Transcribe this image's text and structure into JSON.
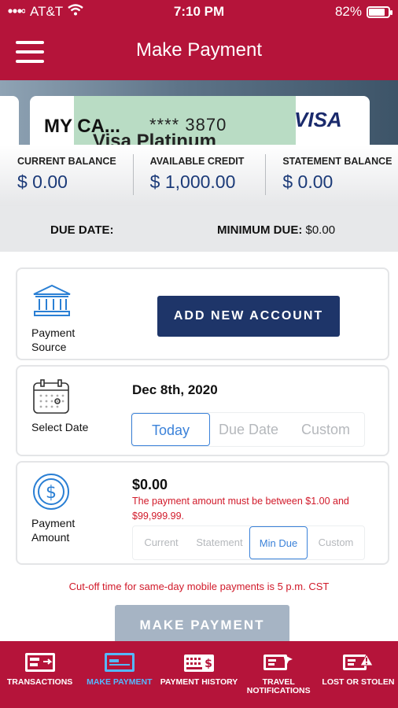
{
  "status": {
    "carrier": "AT&T",
    "time": "7:10 PM",
    "battery": "82%",
    "battery_level": 0.82
  },
  "header": {
    "title": "Make Payment",
    "menu_icon": "hamburger-icon"
  },
  "card": {
    "name": "MY CA...",
    "number": "**** 3870",
    "product": "Visa Platinum",
    "brand": "VISA"
  },
  "balances": [
    {
      "label": "CURRENT BALANCE",
      "value": "$ 0.00"
    },
    {
      "label": "AVAILABLE CREDIT",
      "value": "$ 1,000.00"
    },
    {
      "label": "STATEMENT BALANCE",
      "value": "$ 0.00"
    }
  ],
  "due": {
    "due_label": "DUE DATE:",
    "min_label": "MINIMUM DUE:",
    "min_value": "$0.00"
  },
  "payment_source": {
    "label": "Payment Source",
    "button": "ADD NEW ACCOUNT",
    "icon": "bank-icon"
  },
  "select_date": {
    "label": "Select Date",
    "date": "Dec 8th, 2020",
    "options": [
      "Today",
      "Due Date",
      "Custom"
    ],
    "selected": "Today",
    "icon": "calendar-icon"
  },
  "payment_amount": {
    "label": "Payment Amount",
    "amount": "$0.00",
    "error": "The payment amount must be between $1.00 and $99,999.99.",
    "options": [
      "Current",
      "Statement",
      "Min Due",
      "Custom"
    ],
    "selected": "Min Due",
    "icon": "dollar-icon"
  },
  "cutoff_note": "Cut-off time for same-day mobile payments is 5 p.m. CST",
  "make_payment_button": "MAKE PAYMENT",
  "tabs": [
    {
      "label": "TRANSACTIONS",
      "icon": "transactions-icon"
    },
    {
      "label": "MAKE PAYMENT",
      "icon": "card-payment-icon",
      "active": true
    },
    {
      "label": "PAYMENT HISTORY",
      "icon": "payment-history-icon"
    },
    {
      "label": "TRAVEL NOTIFICATIONS",
      "icon": "travel-notifications-icon"
    },
    {
      "label": "LOST OR STOLEN",
      "icon": "lost-stolen-icon"
    }
  ],
  "colors": {
    "brand_red": "#b5143a",
    "navy": "#1e3569",
    "selected_blue": "#3b82d9",
    "error_red": "#d11a2a",
    "disabled_button": "#a6b4c4"
  }
}
